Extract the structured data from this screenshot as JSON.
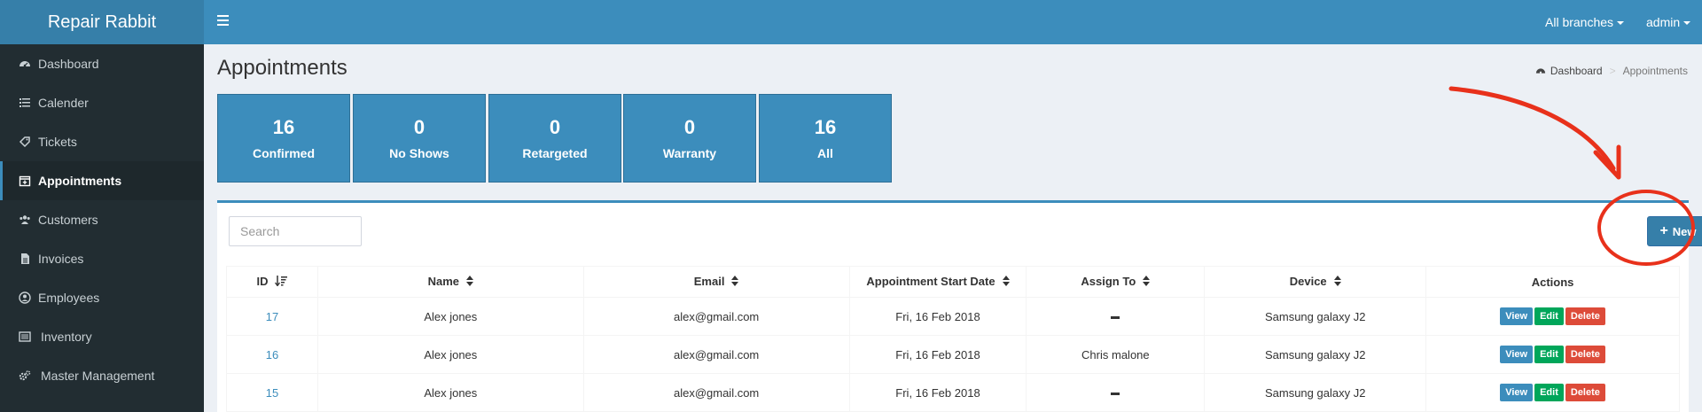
{
  "app": {
    "brand": "Repair Rabbit"
  },
  "header": {
    "branches_label": "All branches",
    "user_label": "admin"
  },
  "sidebar": {
    "items": [
      {
        "label": "Dashboard",
        "icon": "dashboard-icon"
      },
      {
        "label": "Calender",
        "icon": "list-icon"
      },
      {
        "label": "Tickets",
        "icon": "ticket-icon"
      },
      {
        "label": "Appointments",
        "icon": "calendar-plus-icon"
      },
      {
        "label": "Customers",
        "icon": "users-icon"
      },
      {
        "label": "Invoices",
        "icon": "file-icon"
      },
      {
        "label": "Employees",
        "icon": "user-circle-icon"
      },
      {
        "label": "Inventory",
        "icon": "inventory-icon"
      },
      {
        "label": "Master Management",
        "icon": "cogs-icon"
      }
    ]
  },
  "page": {
    "title": "Appointments",
    "breadcrumb": {
      "home": "Dashboard",
      "current": "Appointments"
    }
  },
  "stats": [
    {
      "value": "16",
      "label": "Confirmed"
    },
    {
      "value": "0",
      "label": "No Shows"
    },
    {
      "value": "0",
      "label": "Retargeted"
    },
    {
      "value": "0",
      "label": "Warranty"
    },
    {
      "value": "16",
      "label": "All"
    }
  ],
  "toolbar": {
    "search_placeholder": "Search",
    "new_label": "New"
  },
  "table": {
    "columns": [
      "ID",
      "Name",
      "Email",
      "Appointment Start Date",
      "Assign To",
      "Device",
      "Actions"
    ],
    "rows": [
      {
        "id": "17",
        "name": "Alex jones",
        "email": "alex@gmail.com",
        "date": "Fri, 16 Feb 2018",
        "assign": "",
        "device": "Samsung galaxy J2"
      },
      {
        "id": "16",
        "name": "Alex jones",
        "email": "alex@gmail.com",
        "date": "Fri, 16 Feb 2018",
        "assign": "Chris malone",
        "device": "Samsung galaxy J2"
      },
      {
        "id": "15",
        "name": "Alex jones",
        "email": "alex@gmail.com",
        "date": "Fri, 16 Feb 2018",
        "assign": "",
        "device": "Samsung galaxy J2"
      }
    ],
    "actions": {
      "view": "View",
      "edit": "Edit",
      "delete": "Delete"
    }
  },
  "colors": {
    "primary": "#3c8dbc",
    "sidebar": "#222d32",
    "success": "#00a65a",
    "danger": "#dd4b39",
    "annotation": "#e8311b"
  }
}
